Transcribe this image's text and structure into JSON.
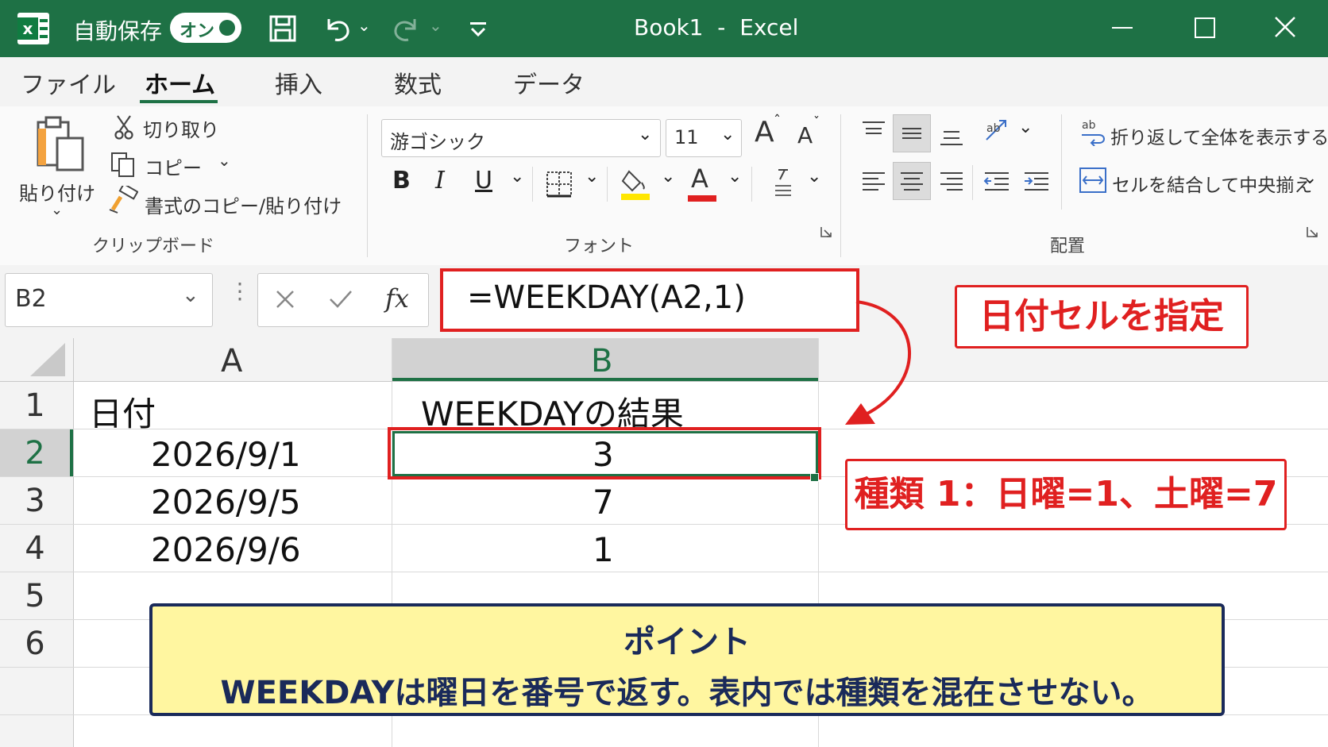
{
  "titlebar": {
    "autosave_label": "自動保存",
    "autosave_toggle": "オン",
    "window_title": "Book1  -  Excel"
  },
  "tabs": [
    {
      "label": "ファイル"
    },
    {
      "label": "ホーム"
    },
    {
      "label": "挿入"
    },
    {
      "label": "数式"
    },
    {
      "label": "データ"
    }
  ],
  "ribbon": {
    "clipboard": {
      "paste": "貼り付け",
      "cut": "切り取り",
      "copy": "コピー",
      "format_painter": "書式のコピー/貼り付け",
      "group_label": "クリップボード"
    },
    "font": {
      "font_name": "游ゴシック",
      "font_size": "11",
      "grow": "A",
      "shrink": "A",
      "bold": "B",
      "italic": "I",
      "underline": "U",
      "font_color_glyph": "A",
      "group_label": "フォント",
      "highlight_color": "#ffe600",
      "font_color": "#e02020"
    },
    "alignment": {
      "wrap_text": "折り返して全体を表示する",
      "merge_center": "セルを結合して中央揃え",
      "group_label": "配置"
    }
  },
  "formula_bar": {
    "name_box": "B2",
    "fx": "fx",
    "formula": "=WEEKDAY(A2,1)"
  },
  "sheet": {
    "columns": [
      "A",
      "B"
    ],
    "rows": [
      "1",
      "2",
      "3",
      "4",
      "5",
      "6"
    ],
    "cells": {
      "A1": "日付",
      "B1": "WEEKDAYの結果",
      "A2": "2026/9/1",
      "B2": "3",
      "A3": "2026/9/5",
      "B3": "7",
      "A4": "2026/9/6",
      "B4": "1"
    }
  },
  "annotations": {
    "callout_cell": "日付セルを指定",
    "callout_type": "種類 1：日曜=1、土曜=7",
    "point_title": "ポイント",
    "point_body": "WEEKDAYは曜日を番号で返す。表内では種類を混在させない。"
  },
  "colors": {
    "excel_green": "#1e7145",
    "accent_red": "#e02020",
    "note_yellow": "#fff6a0",
    "note_border": "#1a2a5a"
  }
}
